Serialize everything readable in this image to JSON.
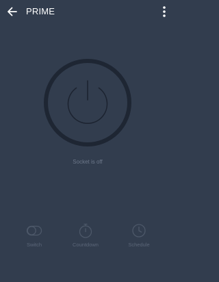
{
  "header": {
    "title": "PRIME",
    "back_icon": "arrow-left-icon",
    "menu_icon": "more-vertical-icon"
  },
  "power": {
    "icon": "power-icon",
    "status_text": "Socket is off"
  },
  "bottom_bar": {
    "items": [
      {
        "label": "Switch",
        "icon": "switch-icon"
      },
      {
        "label": "Countdown",
        "icon": "countdown-icon"
      },
      {
        "label": "Schedule",
        "icon": "schedule-icon"
      }
    ]
  },
  "colors": {
    "background": "#323d4e",
    "ring": "#1e2633",
    "icon_dim": "#1c2330",
    "status_text": "#6d788a",
    "bottom_icon": "#4d5869",
    "title_text": "#ffffff"
  }
}
